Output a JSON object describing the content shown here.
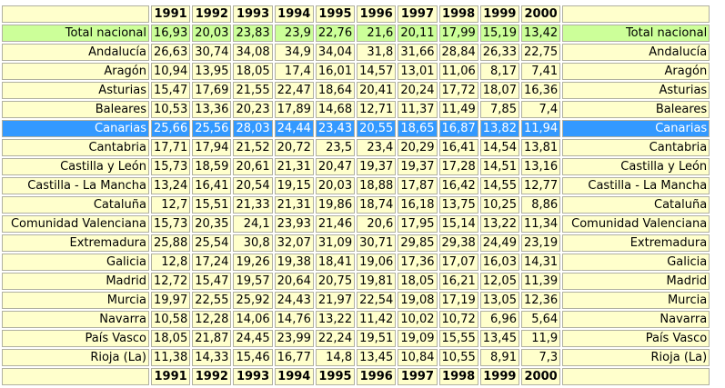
{
  "years": [
    "1991",
    "1992",
    "1993",
    "1994",
    "1995",
    "1996",
    "1997",
    "1998",
    "1999",
    "2000"
  ],
  "colors": {
    "cell": "#ffffcc",
    "total_row": "#ccff99",
    "selected_row": "#3399ff",
    "selected_text": "#ffffff"
  },
  "rows": [
    {
      "name": "Total nacional",
      "values": [
        "16,93",
        "20,03",
        "23,83",
        "23,9",
        "22,76",
        "21,6",
        "20,11",
        "17,99",
        "15,19",
        "13,42"
      ],
      "style": "total"
    },
    {
      "name": "Andalucía",
      "values": [
        "26,63",
        "30,74",
        "34,08",
        "34,9",
        "34,04",
        "31,8",
        "31,66",
        "28,84",
        "26,33",
        "22,75"
      ]
    },
    {
      "name": "Aragón",
      "values": [
        "10,94",
        "13,95",
        "18,05",
        "17,4",
        "16,01",
        "14,57",
        "13,01",
        "11,06",
        "8,17",
        "7,41"
      ]
    },
    {
      "name": "Asturias",
      "values": [
        "15,47",
        "17,69",
        "21,55",
        "22,47",
        "18,64",
        "20,41",
        "20,24",
        "17,72",
        "18,07",
        "16,36"
      ]
    },
    {
      "name": "Baleares",
      "values": [
        "10,53",
        "13,36",
        "20,23",
        "17,89",
        "14,68",
        "12,71",
        "11,37",
        "11,49",
        "7,85",
        "7,4"
      ]
    },
    {
      "name": "Canarias",
      "values": [
        "25,66",
        "25,56",
        "28,03",
        "24,44",
        "23,43",
        "20,55",
        "18,65",
        "16,87",
        "13,82",
        "11,94"
      ],
      "style": "selected"
    },
    {
      "name": "Cantabria",
      "values": [
        "17,71",
        "17,94",
        "21,52",
        "20,72",
        "23,5",
        "23,4",
        "20,29",
        "16,41",
        "14,54",
        "13,81"
      ]
    },
    {
      "name": "Castilla y León",
      "values": [
        "15,73",
        "18,59",
        "20,61",
        "21,31",
        "20,47",
        "19,37",
        "19,37",
        "17,28",
        "14,51",
        "13,16"
      ]
    },
    {
      "name": "Castilla - La Mancha",
      "values": [
        "13,24",
        "16,41",
        "20,54",
        "19,15",
        "20,03",
        "18,88",
        "17,87",
        "16,42",
        "14,55",
        "12,77"
      ]
    },
    {
      "name": "Cataluña",
      "values": [
        "12,7",
        "15,51",
        "21,33",
        "21,31",
        "19,86",
        "18,74",
        "16,18",
        "13,75",
        "10,25",
        "8,86"
      ]
    },
    {
      "name": "Comunidad Valenciana",
      "values": [
        "15,73",
        "20,35",
        "24,1",
        "23,93",
        "21,46",
        "20,6",
        "17,95",
        "15,14",
        "13,22",
        "11,34"
      ]
    },
    {
      "name": "Extremadura",
      "values": [
        "25,88",
        "25,54",
        "30,8",
        "32,07",
        "31,09",
        "30,71",
        "29,85",
        "29,38",
        "24,49",
        "23,19"
      ]
    },
    {
      "name": "Galicia",
      "values": [
        "12,8",
        "17,24",
        "19,26",
        "19,38",
        "18,41",
        "19,06",
        "17,36",
        "17,07",
        "16,03",
        "14,31"
      ]
    },
    {
      "name": "Madrid",
      "values": [
        "12,72",
        "15,47",
        "19,57",
        "20,64",
        "20,75",
        "19,81",
        "18,05",
        "16,21",
        "12,05",
        "11,39"
      ]
    },
    {
      "name": "Murcia",
      "values": [
        "19,97",
        "22,55",
        "25,92",
        "24,43",
        "21,97",
        "22,54",
        "19,08",
        "17,19",
        "13,05",
        "12,36"
      ]
    },
    {
      "name": "Navarra",
      "values": [
        "10,58",
        "12,28",
        "14,06",
        "14,76",
        "13,22",
        "11,42",
        "10,02",
        "10,72",
        "6,96",
        "5,64"
      ]
    },
    {
      "name": "País Vasco",
      "values": [
        "18,05",
        "21,87",
        "24,45",
        "23,99",
        "22,24",
        "19,51",
        "19,09",
        "15,55",
        "13,45",
        "11,9"
      ]
    },
    {
      "name": "Rioja (La)",
      "values": [
        "11,38",
        "14,33",
        "15,46",
        "16,77",
        "14,8",
        "13,45",
        "10,84",
        "10,55",
        "8,91",
        "7,3"
      ]
    }
  ]
}
